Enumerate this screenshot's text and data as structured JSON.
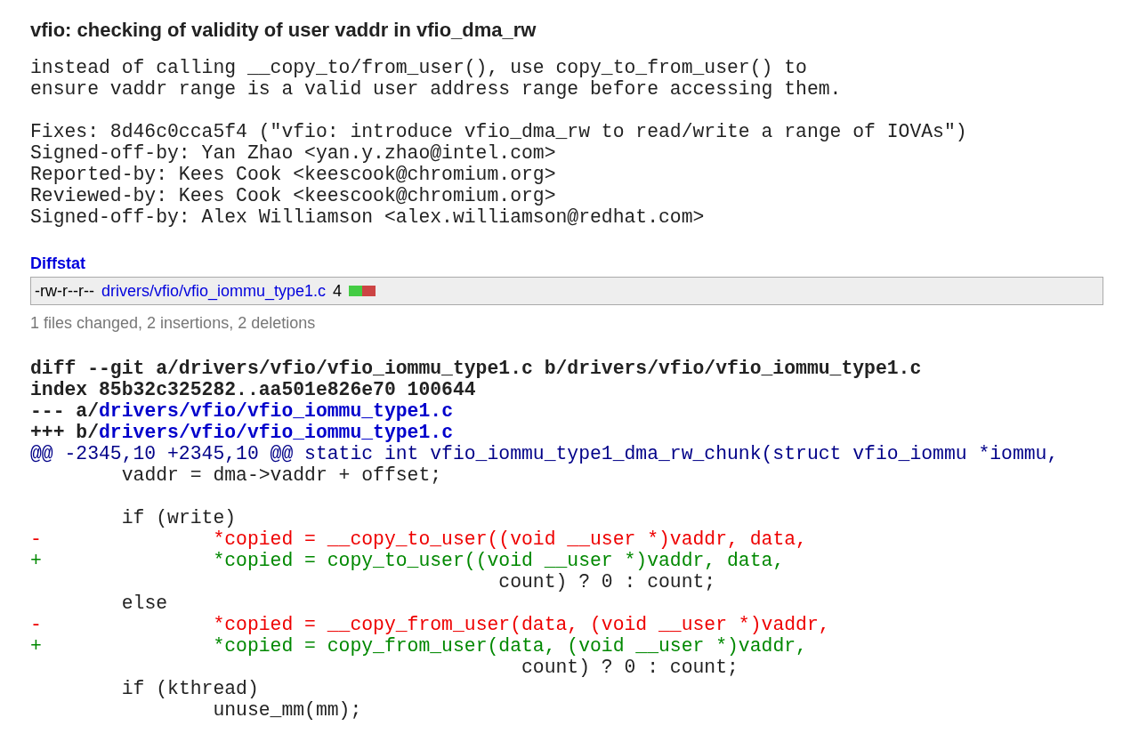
{
  "title": "vfio: checking of validity of user vaddr in vfio_dma_rw",
  "message": [
    "instead of calling __copy_to/from_user(), use copy_to_from_user() to",
    "ensure vaddr range is a valid user address range before accessing them."
  ],
  "trailers": [
    "Fixes: 8d46c0cca5f4 (\"vfio: introduce vfio_dma_rw to read/write a range of IOVAs\")",
    "Signed-off-by: Yan Zhao <yan.y.zhao@intel.com>",
    "Reported-by: Kees Cook <keescook@chromium.org>",
    "Reviewed-by: Kees Cook <keescook@chromium.org>",
    "Signed-off-by: Alex Williamson <alex.williamson@redhat.com>"
  ],
  "diffstat": {
    "heading": "Diffstat",
    "files": [
      {
        "mode": "-rw-r--r--",
        "path": "drivers/vfio/vfio_iommu_type1.c",
        "count": "4",
        "graph": {
          "level": 0.5
        }
      }
    ],
    "summary": "1 files changed, 2 insertions, 2 deletions"
  },
  "diff": [
    {
      "kind": "header",
      "text": "diff --git a/drivers/vfio/vfio_iommu_type1.c b/drivers/vfio/vfio_iommu_type1.c"
    },
    {
      "kind": "header",
      "text": "index 85b32c325282..aa501e826e70 100644"
    },
    {
      "kind": "file",
      "prefix": "--- a/",
      "path": "drivers/vfio/vfio_iommu_type1.c"
    },
    {
      "kind": "file",
      "prefix": "+++ b/",
      "path": "drivers/vfio/vfio_iommu_type1.c"
    },
    {
      "kind": "hunk",
      "text": "@@ -2345,10 +2345,10 @@ static int vfio_iommu_type1_dma_rw_chunk(struct vfio_iommu *iommu,"
    },
    {
      "kind": "context",
      "text": " \tvaddr = dma->vaddr + offset;"
    },
    {
      "kind": "blank"
    },
    {
      "kind": "context",
      "text": " \tif (write)"
    },
    {
      "kind": "del",
      "text": "-\t\t*copied = __copy_to_user((void __user *)vaddr, data,"
    },
    {
      "kind": "add",
      "text": "+\t\t*copied = copy_to_user((void __user *)vaddr, data,"
    },
    {
      "kind": "context",
      "text": " \t\t\t\t\t count) ? 0 : count;"
    },
    {
      "kind": "context",
      "text": " \telse"
    },
    {
      "kind": "del",
      "text": "-\t\t*copied = __copy_from_user(data, (void __user *)vaddr,"
    },
    {
      "kind": "add",
      "text": "+\t\t*copied = copy_from_user(data, (void __user *)vaddr,"
    },
    {
      "kind": "context",
      "text": " \t\t\t\t\t   count) ? 0 : count;"
    },
    {
      "kind": "context",
      "text": " \tif (kthread)"
    },
    {
      "kind": "context",
      "text": " \t\tunuse_mm(mm);"
    }
  ]
}
